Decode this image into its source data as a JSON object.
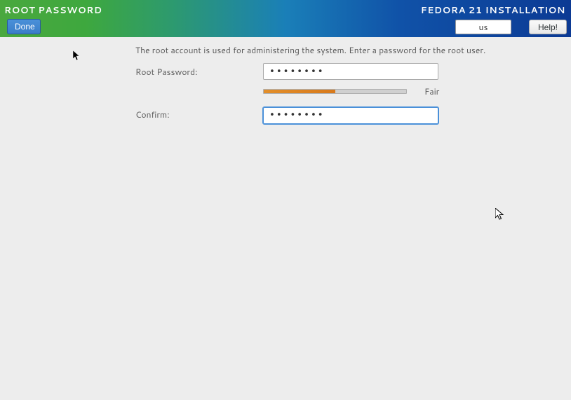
{
  "header": {
    "title": "ROOT PASSWORD",
    "done_label": "Done",
    "install_title": "FEDORA 21 INSTALLATION",
    "keyboard_layout": "us",
    "help_label": "Help!"
  },
  "form": {
    "description": "The root account is used for administering the system.  Enter a password for the root user.",
    "password_label": "Root Password:",
    "password_value": "••••••••",
    "confirm_label": "Confirm:",
    "confirm_value": "••••••••",
    "strength_label": "Fair",
    "strength_percent": 50
  }
}
